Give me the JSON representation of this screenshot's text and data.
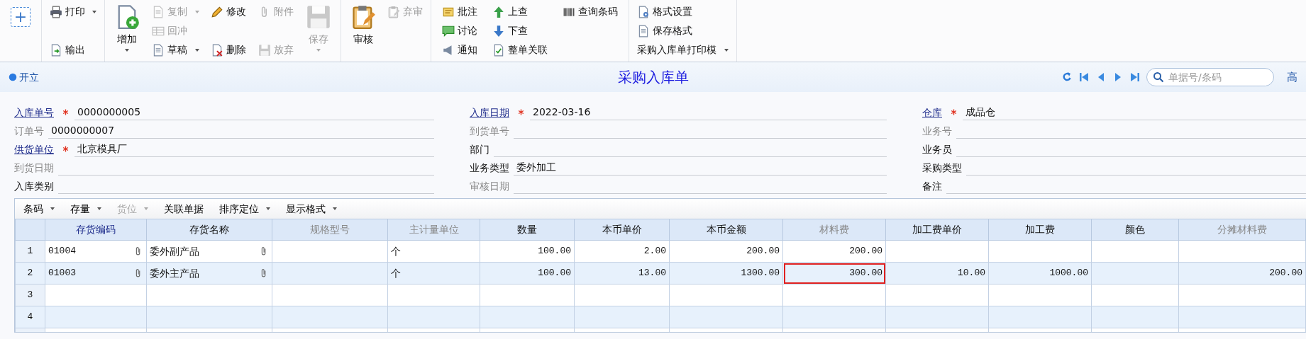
{
  "toolbar": {
    "groups": [
      {
        "columns": [
          {
            "items": [
              {
                "kind": "plus",
                "label": "+"
              }
            ]
          }
        ]
      },
      {
        "columns": [
          {
            "items": [
              {
                "kind": "small",
                "label": "打印",
                "disabled": false,
                "dropdown": true
              },
              {
                "kind": "small",
                "label": "输出",
                "disabled": false,
                "dropdown": false
              }
            ]
          }
        ]
      },
      {
        "columns": [
          {
            "items": [
              {
                "kind": "big",
                "label": "增加",
                "disabled": false,
                "dropdown": true
              }
            ]
          },
          {
            "items": [
              {
                "kind": "small",
                "label": "复制",
                "disabled": true,
                "dropdown": true
              },
              {
                "kind": "small",
                "label": "回冲",
                "disabled": true,
                "dropdown": false
              },
              {
                "kind": "small",
                "label": "草稿",
                "disabled": false,
                "dropdown": true
              }
            ]
          },
          {
            "items": [
              {
                "kind": "small",
                "label": "修改",
                "disabled": false,
                "dropdown": false
              },
              {
                "kind": "small",
                "label": "删除",
                "disabled": false,
                "dropdown": false
              }
            ]
          },
          {
            "items": [
              {
                "kind": "small",
                "label": "附件",
                "disabled": true,
                "dropdown": false
              },
              {
                "kind": "small",
                "label": "放弃",
                "disabled": true,
                "dropdown": false
              }
            ]
          },
          {
            "items": [
              {
                "kind": "big",
                "label": "保存",
                "disabled": true,
                "dropdown": true
              }
            ]
          }
        ]
      },
      {
        "columns": [
          {
            "items": [
              {
                "kind": "big",
                "label": "审核",
                "disabled": false,
                "dropdown": false
              }
            ]
          },
          {
            "items": [
              {
                "kind": "small",
                "label": "弃审",
                "disabled": true,
                "dropdown": false
              }
            ]
          }
        ]
      },
      {
        "columns": [
          {
            "items": [
              {
                "kind": "small",
                "label": "批注",
                "disabled": false,
                "dropdown": false
              },
              {
                "kind": "small",
                "label": "讨论",
                "disabled": false,
                "dropdown": false
              },
              {
                "kind": "small",
                "label": "通知",
                "disabled": false,
                "dropdown": false
              }
            ]
          },
          {
            "items": [
              {
                "kind": "small",
                "label": "上查",
                "disabled": false,
                "dropdown": false
              },
              {
                "kind": "small",
                "label": "下查",
                "disabled": false,
                "dropdown": false
              },
              {
                "kind": "small",
                "label": "整单关联",
                "disabled": false,
                "dropdown": false
              }
            ]
          },
          {
            "items": [
              {
                "kind": "small",
                "label": "查询条码",
                "disabled": false,
                "dropdown": false
              }
            ]
          }
        ]
      },
      {
        "columns": [
          {
            "items": [
              {
                "kind": "small",
                "label": "格式设置",
                "disabled": false,
                "dropdown": false
              },
              {
                "kind": "small",
                "label": "保存格式",
                "disabled": false,
                "dropdown": false
              },
              {
                "kind": "text",
                "label": "采购入库单打印模",
                "disabled": false,
                "dropdown": true
              }
            ]
          }
        ]
      }
    ]
  },
  "header": {
    "status": "开立",
    "title": "采购入库单",
    "search": {
      "placeholder": "单据号/条码"
    },
    "advanced_link": "高"
  },
  "form": {
    "columns": [
      {
        "fields": [
          {
            "label": "入库单号",
            "kind": "link",
            "required": true,
            "value": "0000000005"
          },
          {
            "label": "订单号",
            "kind": "muted",
            "required": false,
            "value": "0000000007"
          },
          {
            "label": "供货单位",
            "kind": "link",
            "required": true,
            "value": "北京模具厂"
          },
          {
            "label": "到货日期",
            "kind": "muted",
            "required": false
          },
          {
            "label": "入库类别",
            "kind": "plain",
            "required": false
          }
        ]
      },
      {
        "fields": [
          {
            "label": "入库日期",
            "kind": "link",
            "required": true,
            "value": "2022-03-16"
          },
          {
            "label": "到货单号",
            "kind": "muted",
            "required": false
          },
          {
            "label": "部门",
            "kind": "plain",
            "required": false
          },
          {
            "label": "业务类型",
            "kind": "plain",
            "required": false,
            "value": "委外加工"
          },
          {
            "label": "审核日期",
            "kind": "muted",
            "required": false
          }
        ]
      },
      {
        "fields": [
          {
            "label": "仓库",
            "kind": "link",
            "required": true,
            "value": "成品仓"
          },
          {
            "label": "业务号",
            "kind": "muted",
            "required": false
          },
          {
            "label": "业务员",
            "kind": "plain",
            "required": false
          },
          {
            "label": "采购类型",
            "kind": "plain",
            "required": false
          },
          {
            "label": "备注",
            "kind": "plain",
            "required": false
          }
        ]
      }
    ]
  },
  "grid_toolbar": [
    {
      "label": "条码",
      "disabled": false,
      "dropdown": true
    },
    {
      "label": "存量",
      "disabled": false,
      "dropdown": true
    },
    {
      "label": "货位",
      "disabled": true,
      "dropdown": true
    },
    {
      "label": "关联单据",
      "disabled": false,
      "dropdown": false
    },
    {
      "label": "排序定位",
      "disabled": false,
      "dropdown": true
    },
    {
      "label": "显示格式",
      "disabled": false,
      "dropdown": true
    }
  ],
  "table": {
    "columns": [
      {
        "label": "存货编码",
        "kind": "key",
        "numeric": false,
        "attachment": true
      },
      {
        "label": "存货名称",
        "kind": "plain",
        "numeric": false,
        "attachment": true
      },
      {
        "label": "规格型号",
        "kind": "muted"
      },
      {
        "label": "主计量单位",
        "kind": "muted",
        "numeric": false,
        "attachment": false
      },
      {
        "label": "数量",
        "kind": "plain",
        "numeric": true,
        "attachment": false
      },
      {
        "label": "本币单价",
        "kind": "plain",
        "numeric": true,
        "attachment": false
      },
      {
        "label": "本币金额",
        "kind": "plain",
        "numeric": true,
        "attachment": false
      },
      {
        "label": "材料费",
        "kind": "muted",
        "numeric": true,
        "attachment": false
      },
      {
        "label": "加工费单价",
        "kind": "plain",
        "numeric": true,
        "attachment": false
      },
      {
        "label": "加工费",
        "kind": "plain",
        "numeric": true,
        "attachment": false
      },
      {
        "label": "颜色",
        "kind": "plain"
      },
      {
        "label": "分摊材料费",
        "kind": "muted",
        "numeric": true,
        "attachment": false
      }
    ],
    "rows": [
      {
        "number": "1",
        "cells": [
          {
            "text": "01004",
            "outlined": false
          },
          {
            "text": "委外副产品",
            "outlined": false
          },
          {
            "outlined": false
          },
          {
            "text": "个",
            "outlined": false
          },
          {
            "text": "100.00",
            "outlined": false
          },
          {
            "text": "2.00",
            "outlined": false
          },
          {
            "text": "200.00",
            "outlined": false
          },
          {
            "text": "200.00",
            "outlined": false
          },
          {
            "outlined": false
          },
          {
            "outlined": false
          },
          {
            "outlined": false
          },
          {
            "outlined": false
          }
        ]
      },
      {
        "number": "2",
        "cells": [
          {
            "text": "01003",
            "outlined": false
          },
          {
            "text": "委外主产品",
            "outlined": false
          },
          {
            "outlined": false
          },
          {
            "text": "个",
            "outlined": false
          },
          {
            "text": "100.00",
            "outlined": false
          },
          {
            "text": "13.00",
            "outlined": false
          },
          {
            "text": "1300.00",
            "outlined": false
          },
          {
            "text": "300.00",
            "outlined": true
          },
          {
            "text": "10.00",
            "outlined": false
          },
          {
            "text": "1000.00",
            "outlined": false
          },
          {
            "outlined": false
          },
          {
            "text": "200.00",
            "outlined": false
          }
        ]
      },
      {
        "number": "3",
        "cells": [
          {
            "outlined": false
          },
          {
            "outlined": false
          },
          {
            "outlined": false
          },
          {
            "outlined": false
          },
          {
            "outlined": false
          },
          {
            "outlined": false
          },
          {
            "outlined": false
          },
          {
            "outlined": false
          },
          {
            "outlined": false
          },
          {
            "outlined": false
          },
          {
            "outlined": false
          },
          {
            "outlined": false
          }
        ]
      },
      {
        "number": "4",
        "cells": [
          {
            "outlined": false
          },
          {
            "outlined": false
          },
          {
            "outlined": false
          },
          {
            "outlined": false
          },
          {
            "outlined": false
          },
          {
            "outlined": false
          },
          {
            "outlined": false
          },
          {
            "outlined": false
          },
          {
            "outlined": false
          },
          {
            "outlined": false
          },
          {
            "outlined": false
          },
          {
            "outlined": false
          }
        ]
      }
    ]
  }
}
